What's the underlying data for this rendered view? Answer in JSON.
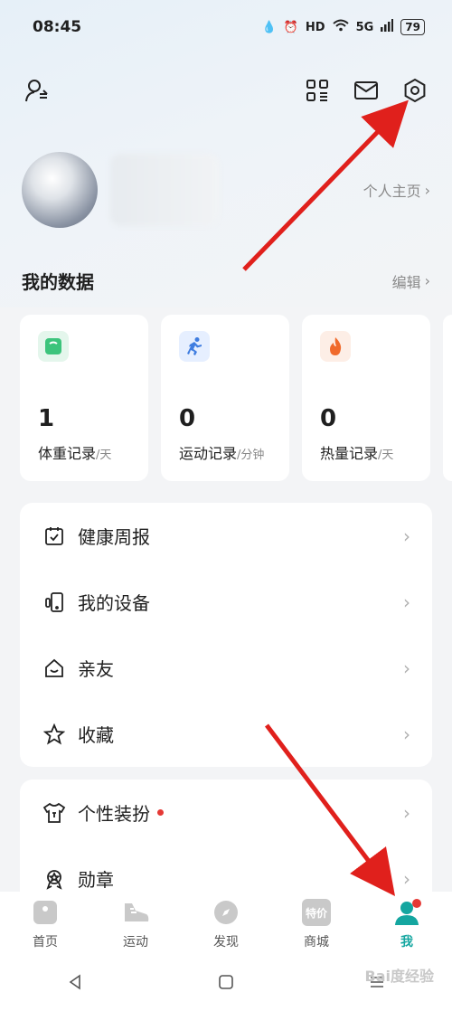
{
  "status_bar": {
    "time": "08:45",
    "battery": "79",
    "network": "5G"
  },
  "profile": {
    "homepage_label": "个人主页"
  },
  "my_data": {
    "title": "我的数据",
    "edit_label": "编辑",
    "cards": [
      {
        "value": "1",
        "label": "体重记录",
        "unit": "/天",
        "icon": "weight-scale-icon",
        "color": "#3cc47c"
      },
      {
        "value": "0",
        "label": "运动记录",
        "unit": "/分钟",
        "icon": "running-icon",
        "color": "#3f7de0"
      },
      {
        "value": "0",
        "label": "热量记录",
        "unit": "/天",
        "icon": "flame-icon",
        "color": "#f06a2c"
      }
    ]
  },
  "menu_group_1": [
    {
      "label": "健康周报",
      "icon": "calendar-check-icon"
    },
    {
      "label": "我的设备",
      "icon": "device-icon"
    },
    {
      "label": "亲友",
      "icon": "home-smile-icon"
    },
    {
      "label": "收藏",
      "icon": "star-icon"
    }
  ],
  "menu_group_2": [
    {
      "label": "个性装扮",
      "icon": "tshirt-icon",
      "badge": true
    },
    {
      "label": "勋章",
      "icon": "medal-icon"
    }
  ],
  "tabbar": [
    {
      "label": "首页",
      "icon": "home-tab-icon"
    },
    {
      "label": "运动",
      "icon": "shoe-tab-icon"
    },
    {
      "label": "发现",
      "icon": "compass-tab-icon"
    },
    {
      "label": "商城",
      "icon": "shop-tab-icon",
      "icon_text": "特价"
    },
    {
      "label": "我",
      "icon": "me-tab-icon",
      "active": true
    }
  ],
  "watermark": "Bai度经验",
  "colors": {
    "accent": "#14a6a0",
    "annotation_arrow": "#e0201c"
  }
}
